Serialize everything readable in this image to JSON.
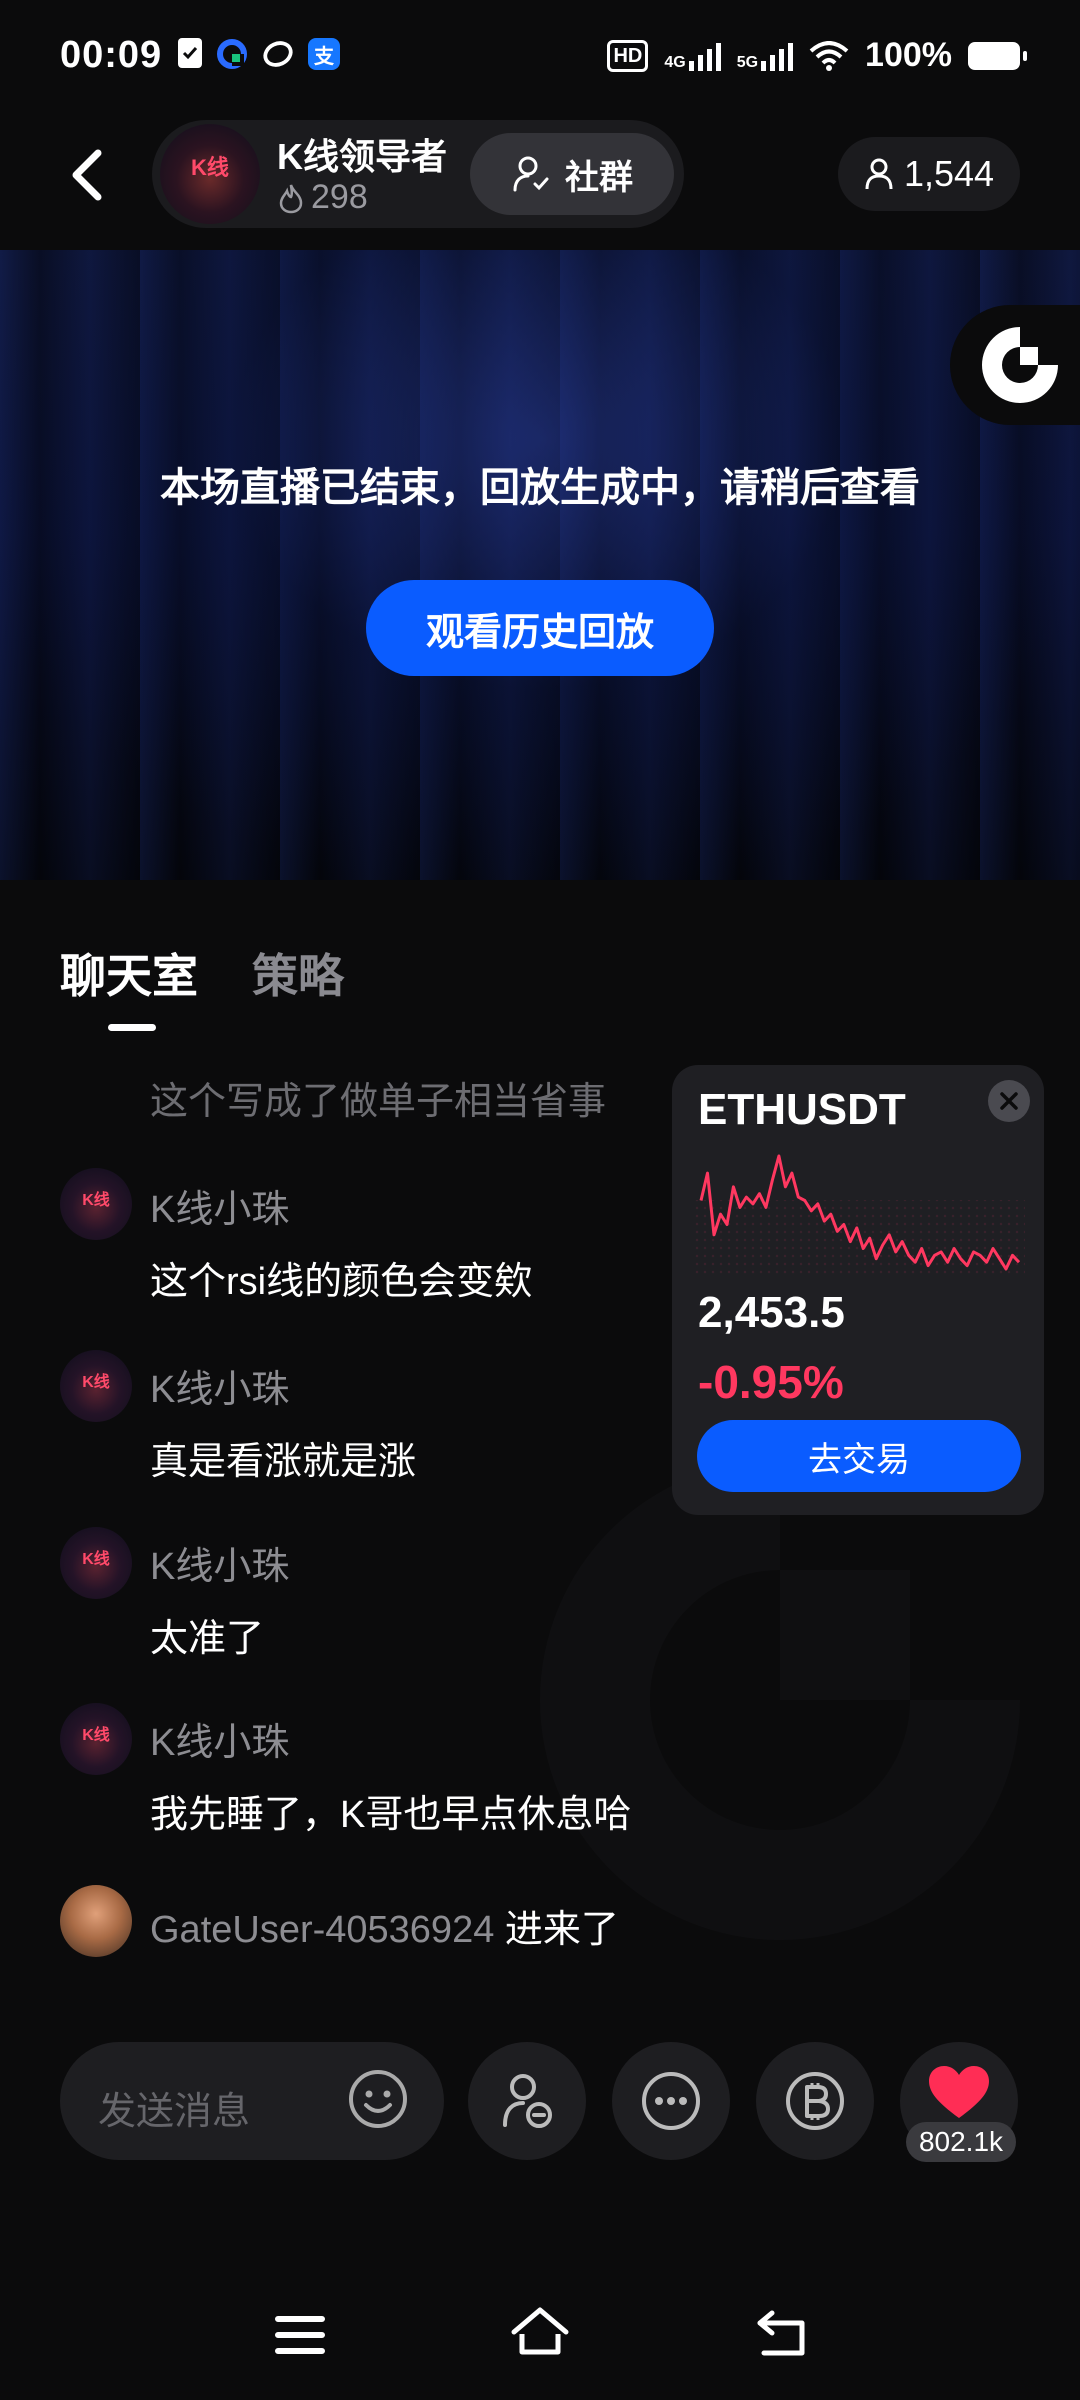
{
  "status_bar": {
    "time": "00:09",
    "network_hd": "HD",
    "network_4g": "4G",
    "network_5g": "5G",
    "battery": "100%",
    "app_icons": [
      "clipboard-icon",
      "browser-icon",
      "swirl-app-icon",
      "alipay-icon"
    ],
    "alipay_glyph": "支"
  },
  "header": {
    "host_name": "K线领导者",
    "host_heat": "298",
    "host_avatar_glyph": "K线",
    "community_label": "社群",
    "viewer_count": "1,544"
  },
  "video": {
    "ended_message": "本场直播已结束，回放生成中，请稍后查看",
    "replay_button": "观看历史回放"
  },
  "tabs": {
    "chat": "聊天室",
    "strategy": "策略"
  },
  "chat": {
    "faded_message": "这个写成了做单子相当省事",
    "avatar_glyph": "K线",
    "messages": [
      {
        "user": "K线小珠",
        "text": "这个rsi线的颜色会变欸"
      },
      {
        "user": "K线小珠",
        "text": "真是看涨就是涨"
      },
      {
        "user": "K线小珠",
        "text": "太准了"
      },
      {
        "user": "K线小珠",
        "text": "我先睡了，K哥也早点休息哈"
      }
    ],
    "join_event": {
      "user": "GateUser-40536924",
      "action": " 进来了"
    }
  },
  "ticker": {
    "symbol": "ETHUSDT",
    "price": "2,453.5",
    "change": "-0.95%",
    "trade_button": "去交易",
    "line_color": "#ff3860",
    "sparkline": [
      62,
      70,
      52,
      58,
      55,
      66,
      60,
      63,
      61,
      64,
      60,
      68,
      75,
      66,
      70,
      63,
      62,
      59,
      61,
      56,
      58,
      53,
      55,
      50,
      54,
      48,
      51,
      45,
      49,
      52,
      47,
      50,
      46,
      44,
      48,
      43,
      46,
      47,
      44,
      48,
      45,
      43,
      47,
      46,
      44,
      48,
      45,
      42,
      46,
      44
    ]
  },
  "bottom_bar": {
    "send_placeholder": "发送消息",
    "like_count": "802.1k"
  },
  "colors": {
    "accent_blue": "#0a5cff",
    "negative_red": "#ff3860",
    "background": "#0b0b0c"
  }
}
